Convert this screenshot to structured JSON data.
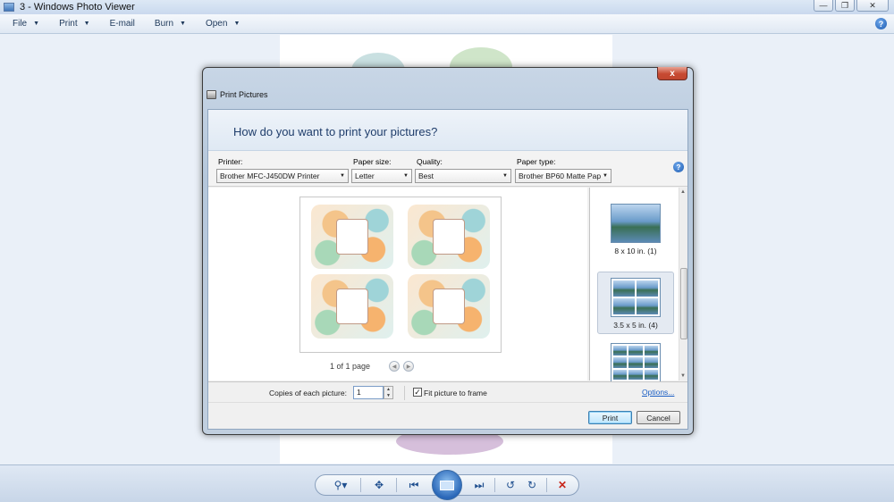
{
  "window": {
    "title": "3 - Windows Photo Viewer",
    "controls": [
      "minimize-icon",
      "restore-icon",
      "close-icon"
    ]
  },
  "menubar": {
    "items": [
      {
        "label": "File",
        "has_dropdown": true
      },
      {
        "label": "Print",
        "has_dropdown": true
      },
      {
        "label": "E-mail",
        "has_dropdown": false
      },
      {
        "label": "Burn",
        "has_dropdown": true
      },
      {
        "label": "Open",
        "has_dropdown": true
      }
    ],
    "help_icon": "help-icon"
  },
  "dialog": {
    "title": "Print Pictures",
    "close_glyph": "x",
    "question": "How do you want to print your pictures?",
    "options": {
      "printer_label": "Printer:",
      "printer_value": "Brother MFC-J450DW Printer",
      "paper_size_label": "Paper size:",
      "paper_size_value": "Letter",
      "quality_label": "Quality:",
      "quality_value": "Best",
      "paper_type_label": "Paper type:",
      "paper_type_value": "Brother BP60 Matte Pap"
    },
    "preview": {
      "page_counter": "1 of 1 page",
      "tiles": 4
    },
    "layouts": [
      {
        "caption": "8 x 10 in. (1)",
        "selected": false
      },
      {
        "caption": "3.5 x 5 in. (4)",
        "selected": true
      },
      {
        "caption": "",
        "selected": false
      }
    ],
    "copies_label": "Copies of each picture:",
    "copies_value": "1",
    "fit_label": "Fit picture to frame",
    "fit_checked": true,
    "options_link": "Options...",
    "print_button": "Print",
    "cancel_button": "Cancel"
  },
  "toolbar": {
    "buttons": [
      "zoom-icon",
      "actual-size-icon",
      "previous-icon",
      "slideshow-icon",
      "next-icon",
      "rotate-left-icon",
      "rotate-right-icon",
      "delete-icon"
    ]
  },
  "colors": {
    "accent": "#1f3d6b",
    "link": "#1a5ec4",
    "close_red": "#c74a32"
  }
}
